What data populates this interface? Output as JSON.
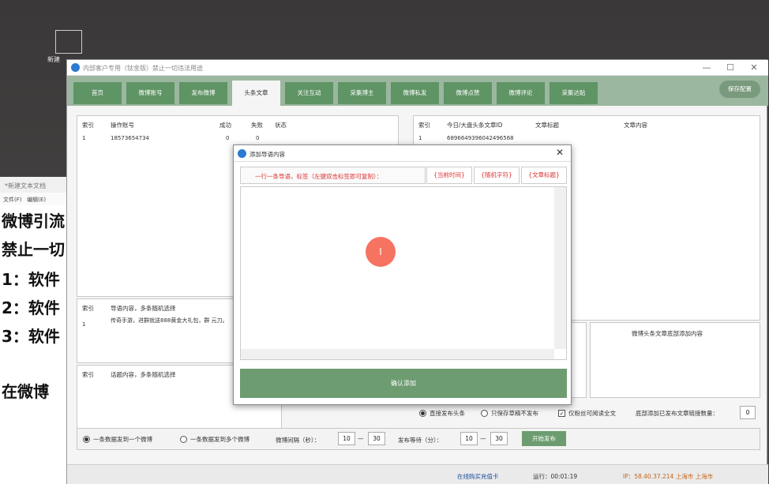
{
  "desktop": {
    "icon_label": "新建"
  },
  "notepad": {
    "title": "*新建文本文档",
    "menu": [
      "文件(F)",
      "编辑(E)"
    ],
    "lines": [
      "微博引流",
      "禁止一切",
      "1：软件",
      "2：软件",
      "3：软件",
      "",
      "在微博"
    ]
  },
  "window": {
    "title": "内部客户专用（钛金版）禁止一切违法用途",
    "controls": [
      "—",
      "☐",
      "✕"
    ]
  },
  "tabs": [
    "首页",
    "微博账号",
    "发布微博",
    "头条文章",
    "关注互动",
    "采集博主",
    "微博私发",
    "微博点赞",
    "微博评论",
    "采集达贴"
  ],
  "active_tab": 3,
  "save_label": "保存配置",
  "accounts": {
    "headers": [
      "索引",
      "操作账号",
      "成功",
      "失败",
      "状态"
    ],
    "rows": [
      [
        "1",
        "18573654734",
        "0",
        "0",
        ""
      ]
    ]
  },
  "articles": {
    "headers": [
      "索引",
      "今日/大盘头条文章ID",
      "文章标题",
      "文章内容"
    ],
    "rows": [
      [
        "1",
        "6896649396042496568",
        "",
        ""
      ]
    ]
  },
  "guide_panel": {
    "headers": [
      "索引",
      "导语内容，多条随机选择"
    ],
    "index": "1",
    "content": "传奇手游，进群就送888黄金大礼包，群 元刀。"
  },
  "topic_panel": {
    "headers": [
      "索引",
      "话题内容，多条随机选择"
    ]
  },
  "tail_panel": {
    "header": "微博头条文章底部添加内容"
  },
  "options": {
    "direct_publish": "直接发布头条",
    "draft_only": "只保存草稿不发布",
    "fans_only": "仅粉丝可阅读全文",
    "bottom_count_label": "底部添加已发布文章链接数量：",
    "bottom_count": "0"
  },
  "publish_mode": {
    "one_to_one": "一条数据发到一个微博",
    "one_to_many": "一条数据发到多个微博"
  },
  "interval": {
    "label": "微博间隔（秒）：",
    "min": "10",
    "max": "30",
    "dash": "—"
  },
  "wait": {
    "label": "发布等待（分）：",
    "min": "10",
    "max": "30"
  },
  "start_label": "开始发布",
  "status": {
    "buy": "在线购买充值卡",
    "runtime": "运行：00:01:19",
    "ip": "IP：58.40.37.214  上海市 上海市"
  },
  "dialog": {
    "title": "添加导语内容",
    "hint": "一行一条导语，标签（左键双击标签即可复制）：",
    "tags": [
      "{当前时间}",
      "{随机字符}",
      "{文章标题}"
    ],
    "confirm": "确认添加",
    "close": "✕"
  },
  "cursor": {
    "glyph": "I"
  },
  "colors": {
    "tab_green": "#5f9465",
    "button_green": "#6c9c70",
    "hint_red": "#d33333"
  }
}
